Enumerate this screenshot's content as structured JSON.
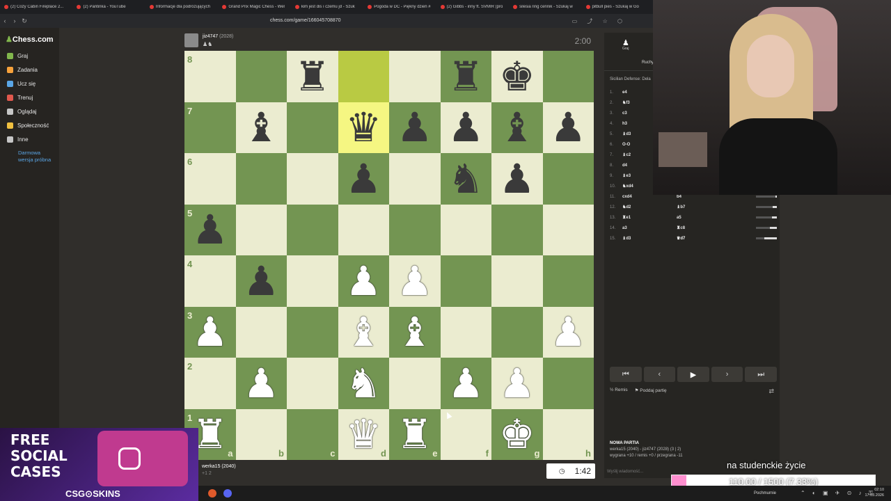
{
  "browser": {
    "tabs": [
      {
        "title": "(2) Cozy Cabin Fireplace 2..."
      },
      {
        "title": "(2) Pantinka - YouTube"
      },
      {
        "title": "Informacje dla podróżujących"
      },
      {
        "title": "Grand Prix Magic Chess - Wel"
      },
      {
        "title": "kim jest dis i czemu jd - Szuk"
      },
      {
        "title": "Pogoda w DC - Piękny dzień #"
      },
      {
        "title": "(2) Gibbs - inny ft. SVMIR (pro"
      },
      {
        "title": "silesia ring cennik - Szukaj w"
      },
      {
        "title": "pitbull pies - Szukaj w Go"
      }
    ],
    "url": "chess.com/game/166045708870"
  },
  "sidebar": {
    "logo": "Chess.com",
    "items": [
      {
        "label": "Graj",
        "icon": "play-icon",
        "color": "#81b64c"
      },
      {
        "label": "Zadania",
        "icon": "puzzle-icon",
        "color": "#f7a23b"
      },
      {
        "label": "Ucz się",
        "icon": "learn-icon",
        "color": "#5aa6e6"
      },
      {
        "label": "Trenuj",
        "icon": "train-icon",
        "color": "#e0584d"
      },
      {
        "label": "Oglądaj",
        "icon": "watch-icon",
        "color": "#c6c6c6"
      },
      {
        "label": "Społeczność",
        "icon": "community-icon",
        "color": "#f0c040"
      },
      {
        "label": "Inne",
        "icon": "more-icon",
        "color": "#c6c6c6"
      }
    ],
    "trial": "Darmowa wersja próbna"
  },
  "top_player": {
    "name": "jiz4747",
    "rating": "(2028)",
    "clock": "2:00",
    "captured": "♟♞"
  },
  "bottom_player": {
    "name": "werka15",
    "rating": "(2040)",
    "clock": "1:42",
    "captured": "+1 2"
  },
  "board": {
    "ranks": [
      "8",
      "7",
      "6",
      "5",
      "4",
      "3",
      "2",
      "1"
    ],
    "files": [
      "a",
      "b",
      "c",
      "d",
      "e",
      "f",
      "g",
      "h"
    ],
    "rows": [
      [
        "",
        "",
        "br",
        "",
        "",
        "br",
        "bk",
        ""
      ],
      [
        "",
        "bb",
        "",
        "bq",
        "bp",
        "bp",
        "bb",
        "bp"
      ],
      [
        "",
        "",
        "",
        "bp",
        "",
        "bn",
        "bp",
        ""
      ],
      [
        "bp",
        "",
        "",
        "",
        "",
        "",
        "",
        ""
      ],
      [
        "",
        "bp",
        "",
        "wp",
        "wp",
        "",
        "",
        ""
      ],
      [
        "wp",
        "",
        "",
        "wb",
        "wb",
        "",
        "",
        "wp"
      ],
      [
        "",
        "wp",
        "",
        "wn",
        "",
        "wp",
        "wp",
        ""
      ],
      [
        "wr",
        "",
        "",
        "wq",
        "wr",
        "",
        "wk",
        ""
      ]
    ],
    "highlight": [
      "d8",
      "d7"
    ]
  },
  "panel": {
    "play_label": "Graj",
    "moves_tab": "Ruchy",
    "opening": "Sicilian Defense: Dela",
    "moves": [
      {
        "n": "1.",
        "w": "e4",
        "b": "",
        "tw": 0
      },
      {
        "n": "2.",
        "w": "♞f3",
        "b": "",
        "tw": 0
      },
      {
        "n": "3.",
        "w": "c3",
        "b": "",
        "tw": 0
      },
      {
        "n": "4.",
        "w": "h3",
        "b": "",
        "tw": 0
      },
      {
        "n": "5.",
        "w": "♝d3",
        "b": "",
        "tw": 0
      },
      {
        "n": "6.",
        "w": "O-O",
        "b": "",
        "tw": 0
      },
      {
        "n": "7.",
        "w": "♝c2",
        "b": "",
        "tw": 0
      },
      {
        "n": "8.",
        "w": "d4",
        "b": "",
        "tw": 0
      },
      {
        "n": "9.",
        "w": "♝e3",
        "b": "",
        "tw": 0
      },
      {
        "n": "10.",
        "w": "♞xd4",
        "b": "",
        "tw": 0
      },
      {
        "n": "11.",
        "w": "cxd4",
        "b": "b4",
        "tw": 0.08
      },
      {
        "n": "12.",
        "w": "♞d2",
        "b": "♝b7",
        "tw": 0.2
      },
      {
        "n": "13.",
        "w": "♜e1",
        "b": "a5",
        "tw": 0.25
      },
      {
        "n": "14.",
        "w": "a3",
        "b": "♜c8",
        "tw": 0.35
      },
      {
        "n": "15.",
        "w": "♝d3",
        "b": "♛d7",
        "tw": 0.6
      }
    ],
    "nav": [
      "⏮",
      "‹",
      "▶",
      "›",
      "⏭"
    ],
    "draw": "Remis",
    "resign": "Poddaj partię",
    "new_game_title": "NOWA PARTIA",
    "new_game_line1": "werka15 (2040) - jiz4747 (2028) (3 | 2)",
    "new_game_line2": "wygrana +10 / remis +0 / przegrana -11",
    "chat_placeholder": "Wyślij wiadomość..."
  },
  "ad": {
    "line1": "FREE",
    "line2": "SOCIAL",
    "line3": "CASES",
    "brand": "CSG⊙SKINS"
  },
  "stream_overlay": {
    "text": "na studenckie życie",
    "progress_label": "110.00 / 1500 (7.33%)",
    "progress": 0.0733
  },
  "taskbar": {
    "weather": "Pochmurnie",
    "time": "02:10",
    "date": "17.03.2026"
  }
}
